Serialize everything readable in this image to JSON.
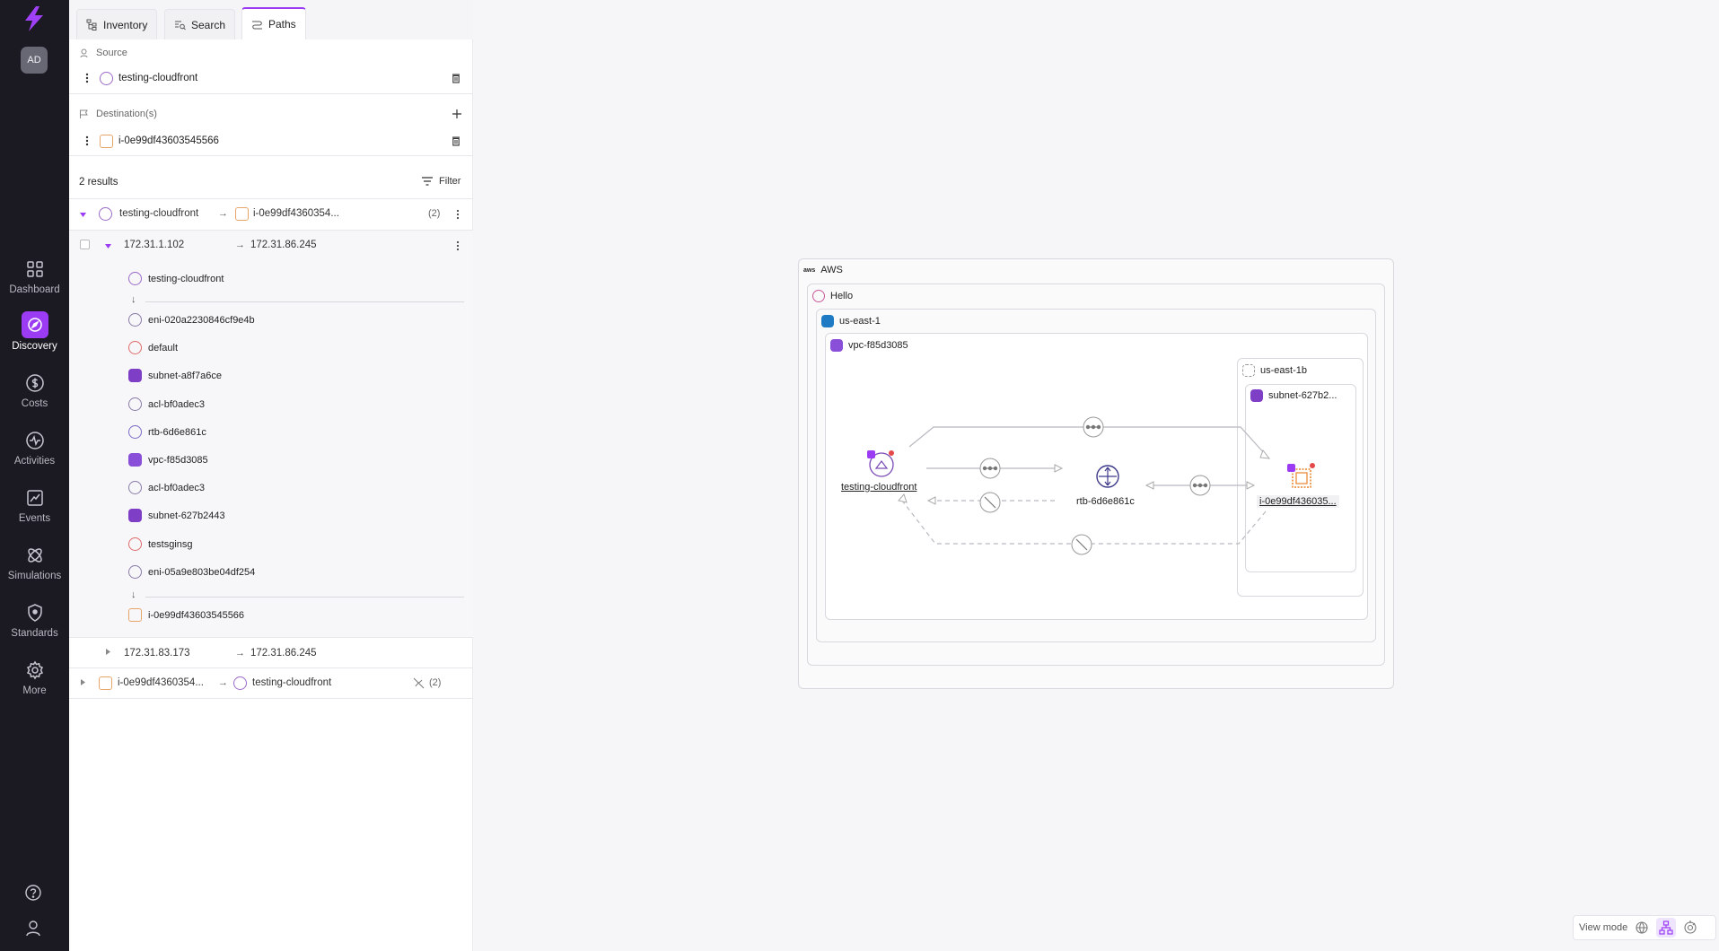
{
  "sidebar": {
    "avatar": "AD",
    "items": [
      {
        "label": "Dashboard",
        "icon": "grid-icon"
      },
      {
        "label": "Discovery",
        "icon": "compass-icon",
        "active": true
      },
      {
        "label": "Costs",
        "icon": "dollar-icon"
      },
      {
        "label": "Activities",
        "icon": "pulse-icon"
      },
      {
        "label": "Events",
        "icon": "chart-icon"
      },
      {
        "label": "Simulations",
        "icon": "atom-icon"
      },
      {
        "label": "Standards",
        "icon": "shield-icon"
      },
      {
        "label": "More",
        "icon": "gear-icon"
      }
    ]
  },
  "tabs": [
    "Inventory",
    "Search",
    "Paths"
  ],
  "source": {
    "label": "Source",
    "value": "testing-cloudfront"
  },
  "destinations": {
    "label": "Destination(s)",
    "value": "i-0e99df43603545566"
  },
  "results": {
    "count": "2 results",
    "filter": "Filter"
  },
  "paths": [
    {
      "from": "testing-cloudfront",
      "to": "i-0e99df4360354...",
      "count": "(2)"
    },
    {
      "from": "i-0e99df4360354...",
      "to": "testing-cloudfront",
      "count": "(2)"
    }
  ],
  "flows": [
    {
      "src": "172.31.1.102",
      "dst": "172.31.86.245"
    },
    {
      "src": "172.31.83.173",
      "dst": "172.31.86.245"
    }
  ],
  "hops": [
    "testing-cloudfront",
    "eni-020a2230846cf9e4b",
    "default",
    "subnet-a8f7a6ce",
    "acl-bf0adec3",
    "rtb-6d6e861c",
    "vpc-f85d3085",
    "acl-bf0adec3",
    "subnet-627b2443",
    "testsginsg",
    "eni-05a9e803be04df254",
    "i-0e99df43603545566"
  ],
  "diagram": {
    "cloud": "AWS",
    "account": "Hello",
    "region": "us-east-1",
    "vpc": "vpc-f85d3085",
    "az": "us-east-1b",
    "subnet": "subnet-627b2...",
    "nodes": {
      "source": "testing-cloudfront",
      "router": "rtb-6d6e861c",
      "target": "i-0e99df436035..."
    }
  },
  "view_mode": "View mode",
  "colors": {
    "accent": "#9b3cf4",
    "sidebar": "#1b1a22",
    "instance": "#e8832b",
    "region": "#1f7bc4"
  }
}
